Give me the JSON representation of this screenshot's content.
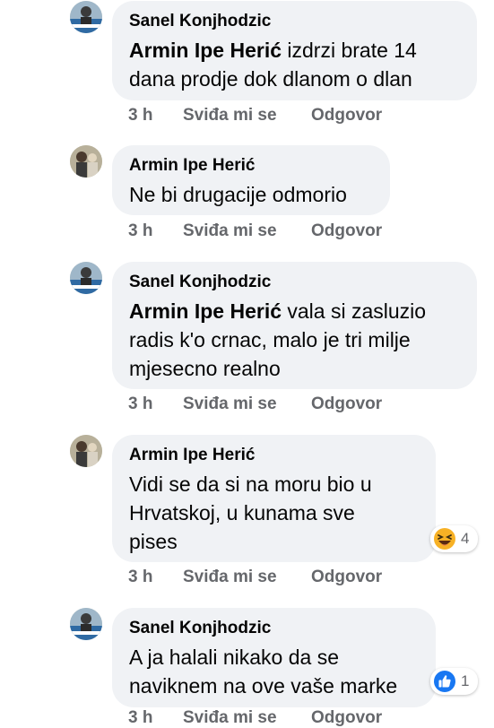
{
  "comments": [
    {
      "author": "Sanel Konjhodzic",
      "mention": "Armin Ipe Herić",
      "text_lines": [
        " izdrzi brate 14",
        "dana prodje dok  dlanom o dlan"
      ],
      "time": "3 h",
      "like_label": "Sviđa mi se",
      "reply_label": "Odgovor",
      "avatar": "avatar-sanel"
    },
    {
      "author": "Armin Ipe Herić",
      "mention": "",
      "text_lines": [
        "Ne bi drugacije odmorio"
      ],
      "time": "3 h",
      "like_label": "Sviđa mi se",
      "reply_label": "Odgovor",
      "avatar": "avatar-armin"
    },
    {
      "author": "Sanel Konjhodzic",
      "mention": "Armin Ipe Herić",
      "text_lines": [
        " vala si zasluzio",
        "radis k'o crnac, malo je tri milje",
        "mjesecno realno"
      ],
      "time": "3 h",
      "like_label": "Sviđa mi se",
      "reply_label": "Odgovor",
      "avatar": "avatar-sanel"
    },
    {
      "author": "Armin Ipe Herić",
      "mention": "",
      "text_lines": [
        "Vidi se da si na moru bio u",
        "Hrvatskoj, u kunama sve",
        "pises"
      ],
      "time": "3 h",
      "like_label": "Sviđa mi se",
      "reply_label": "Odgovor",
      "avatar": "avatar-armin",
      "reaction": {
        "icon": "haha-emoji-icon",
        "count": "4"
      }
    },
    {
      "author": "Sanel Konjhodzic",
      "mention": "",
      "text_lines": [
        "A ja halali nikako da se",
        "naviknem na ove vaše marke"
      ],
      "time": "3 h",
      "like_label": "Sviđa mi se",
      "reply_label": "Odgovor",
      "avatar": "avatar-sanel",
      "reaction": {
        "icon": "like-thumb-icon",
        "count": "1"
      }
    }
  ],
  "colors": {
    "bubble": "#f0f2f5",
    "meta": "#65676b",
    "like_blue": "#1877f2",
    "haha_yellow": "#f7b125"
  }
}
